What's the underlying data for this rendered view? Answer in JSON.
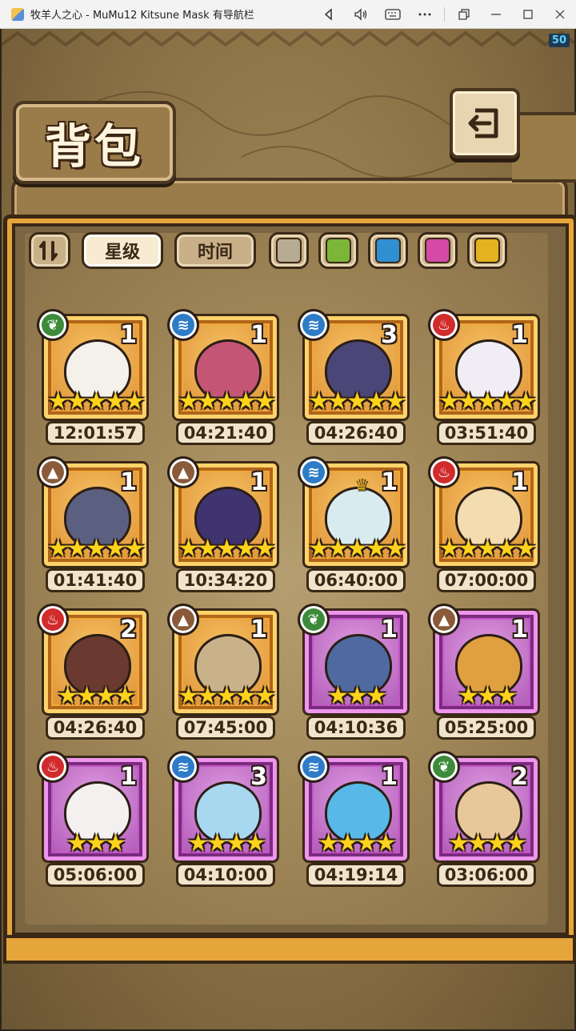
{
  "window": {
    "title": "牧羊人之心 - MuMu12 Kitsune Mask 有导航栏",
    "controls": [
      "back-icon",
      "volume-icon",
      "keyboard-icon",
      "more-icon",
      "restore-icon",
      "minimize-icon",
      "maximize-icon",
      "close-icon"
    ]
  },
  "fps": "50",
  "header": {
    "title": "背包",
    "back_icon": "return-arrow-icon"
  },
  "filters": {
    "sort_icon": "sort-toggle-icon",
    "star_label": "星级",
    "time_label": "时间",
    "active": "星级",
    "swatches": [
      {
        "name": "gray",
        "color": "#b8ab94"
      },
      {
        "name": "green",
        "color": "#7cb638"
      },
      {
        "name": "blue",
        "color": "#2f8fd0"
      },
      {
        "name": "pink",
        "color": "#d44aa6"
      },
      {
        "name": "yellow",
        "color": "#e3b21e"
      }
    ]
  },
  "items": [
    {
      "element": "wood",
      "count": "1",
      "stars": "★★★★★",
      "timer": "12:01:57",
      "frame": "gold",
      "color": "#f4f1ea"
    },
    {
      "element": "water",
      "count": "1",
      "stars": "★★★★★",
      "timer": "04:21:40",
      "frame": "gold",
      "color": "#c45575"
    },
    {
      "element": "water",
      "count": "3",
      "stars": "★★★★★",
      "timer": "04:26:40",
      "frame": "gold",
      "color": "#4a4778"
    },
    {
      "element": "fire",
      "count": "1",
      "stars": "★★★★★",
      "timer": "03:51:40",
      "frame": "gold",
      "color": "#f0eef4"
    },
    {
      "element": "earth",
      "count": "1",
      "stars": "★★★★★",
      "timer": "01:41:40",
      "frame": "gold",
      "color": "#5c6080"
    },
    {
      "element": "earth",
      "count": "1",
      "stars": "★★★★★",
      "timer": "10:34:20",
      "frame": "gold",
      "color": "#3f3470"
    },
    {
      "element": "water",
      "count": "1",
      "stars": "★★★★★",
      "timer": "06:40:00",
      "frame": "gold",
      "color": "#d8ecf0",
      "crown": true
    },
    {
      "element": "fire",
      "count": "1",
      "stars": "★★★★★",
      "timer": "07:00:00",
      "frame": "gold",
      "color": "#f2dcb0"
    },
    {
      "element": "fire",
      "count": "2",
      "stars": "★★★★",
      "timer": "04:26:40",
      "frame": "gold",
      "color": "#6a3a30"
    },
    {
      "element": "earth",
      "count": "1",
      "stars": "★★★★★",
      "timer": "07:45:00",
      "frame": "gold",
      "color": "#c9b28a"
    },
    {
      "element": "wood",
      "count": "1",
      "stars": "★★★",
      "timer": "04:10:36",
      "frame": "purple",
      "color": "#4f6aa0"
    },
    {
      "element": "earth",
      "count": "1",
      "stars": "★★★",
      "timer": "05:25:00",
      "frame": "purple",
      "color": "#e0a040"
    },
    {
      "element": "fire",
      "count": "1",
      "stars": "★★★",
      "timer": "05:06:00",
      "frame": "purple",
      "color": "#f4f0f0"
    },
    {
      "element": "water",
      "count": "3",
      "stars": "★★★★",
      "timer": "04:10:00",
      "frame": "purple",
      "color": "#a8d8f0"
    },
    {
      "element": "water",
      "count": "1",
      "stars": "★★★★",
      "timer": "04:19:14",
      "frame": "purple",
      "color": "#58b8e8"
    },
    {
      "element": "wood",
      "count": "2",
      "stars": "★★★★",
      "timer": "03:06:00",
      "frame": "purple",
      "color": "#e8c89a"
    }
  ]
}
